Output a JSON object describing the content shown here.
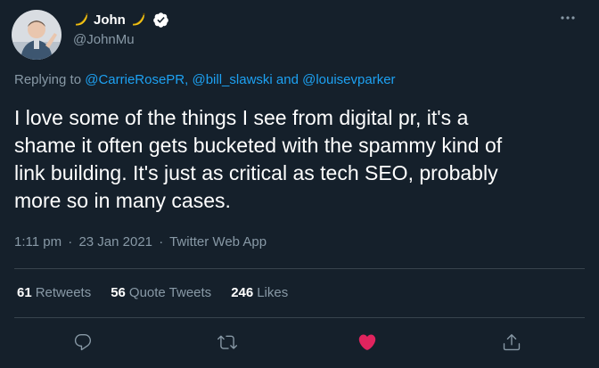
{
  "colors": {
    "background": "#15202b",
    "text_primary": "#ffffff",
    "text_secondary": "#8899a6",
    "link": "#1da1f2",
    "divider": "#38444d",
    "like_active": "#e0245e",
    "verified": "#ffffff",
    "banana": "#f5c518"
  },
  "author": {
    "name": "John",
    "handle": "@JohnMu",
    "name_emoji": "banana-icon",
    "verified_icon": "verified-badge-icon"
  },
  "reply": {
    "prefix": "Replying to",
    "mention_1": "@CarrieRosePR",
    "comma": ",",
    "mention_2": "@bill_slawski",
    "and_word": "and",
    "mention_3": "@louisevparker"
  },
  "tweet": {
    "lines": [
      "I love some of the things I see from digital pr, it's a",
      "shame it often gets bucketed with the spammy kind of",
      "link building. It's just as critical as tech SEO, probably",
      "more so in many cases."
    ]
  },
  "meta": {
    "time": "1:11 pm",
    "dot": "·",
    "date": "23 Jan 2021",
    "source": "Twitter Web App"
  },
  "stats": {
    "retweets_count": "61",
    "retweets_label": "Retweets",
    "quotes_count": "56",
    "quotes_label": "Quote Tweets",
    "likes_count": "246",
    "likes_label": "Likes"
  },
  "actions": {
    "reply_icon": "reply-icon",
    "retweet_icon": "retweet-icon",
    "like_icon": "heart-filled-icon",
    "liked": true,
    "share_icon": "share-icon",
    "more_icon": "more-horizontal-icon"
  }
}
